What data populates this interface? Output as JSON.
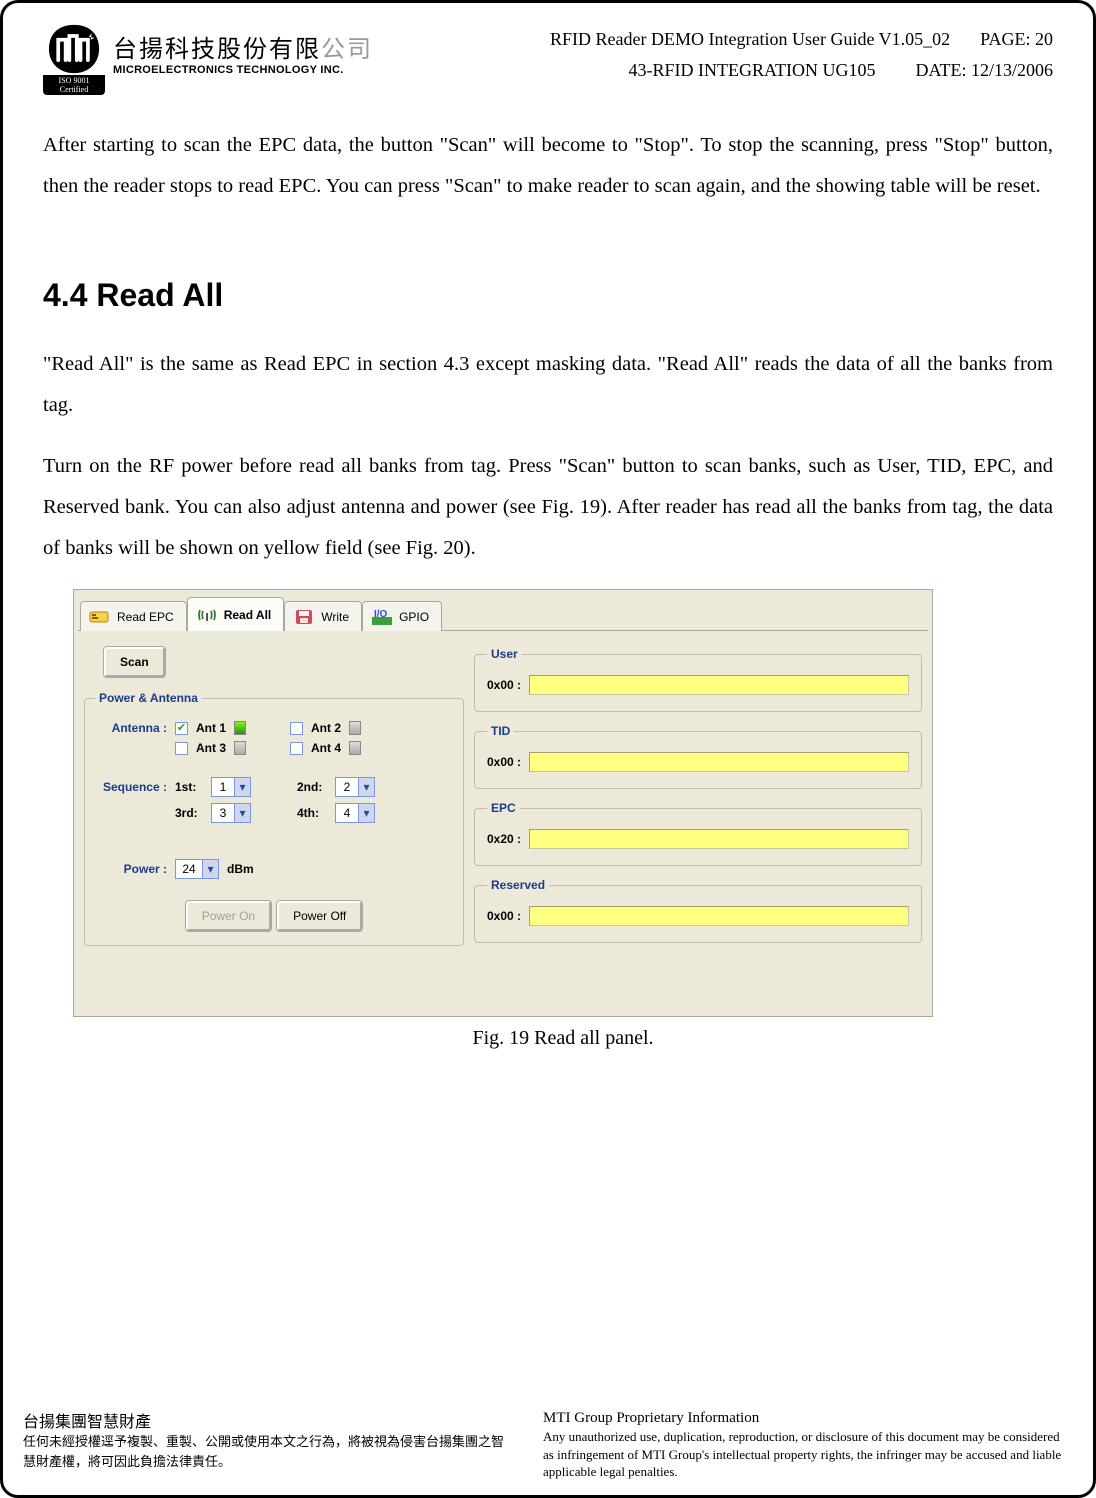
{
  "header": {
    "company_cn_main": "台揚科技股份有限",
    "company_cn_grey": "公司",
    "company_en": "MICROELECTRONICS TECHNOLOGY INC.",
    "iso_cert": "ISO 9001 Certified",
    "doc_title": "RFID Reader DEMO Integration User Guide V1.05_02",
    "page_label": "PAGE: 20",
    "doc_code": "43-RFID INTEGRATION UG105",
    "date_label": "DATE: 12/13/2006"
  },
  "paragraphs": {
    "p1": "After starting to scan the EPC data, the button \"Scan\" will become to \"Stop\". To stop the scanning, press \"Stop\" button, then the reader stops to read EPC.   You can press \"Scan\" to make reader to scan again, and the showing table will be reset.",
    "section_heading": "4.4  Read All",
    "p2": "\"Read All\" is the same as Read EPC in section 4.3 except masking data.   \"Read All\" reads the data of all the banks from tag.",
    "p3": "Turn on the RF power before read all banks from tag. Press \"Scan\" button to scan banks, such as User, TID, EPC, and Reserved bank.   You can also adjust antenna and power (see Fig. 19).   After reader has read all the banks from tag, the data of banks will be shown on yellow field (see Fig. 20)."
  },
  "app": {
    "tabs": {
      "read_epc": "Read EPC",
      "read_all": "Read All",
      "write": "Write",
      "gpio": "GPIO"
    },
    "scan_button": "Scan",
    "group_power_antenna": "Power & Antenna",
    "labels": {
      "antenna": "Antenna :",
      "ant1": "Ant 1",
      "ant2": "Ant 2",
      "ant3": "Ant 3",
      "ant4": "Ant 4",
      "sequence": "Sequence :",
      "seq1": "1st:",
      "seq2": "2nd:",
      "seq3": "3rd:",
      "seq4": "4th:",
      "power": "Power :",
      "dbm": "dBm"
    },
    "values": {
      "seq1": "1",
      "seq2": "2",
      "seq3": "3",
      "seq4": "4",
      "power": "24"
    },
    "buttons": {
      "power_on": "Power On",
      "power_off": "Power Off"
    },
    "readouts": {
      "user": {
        "legend": "User",
        "addr": "0x00 :"
      },
      "tid": {
        "legend": "TID",
        "addr": "0x00 :"
      },
      "epc": {
        "legend": "EPC",
        "addr": "0x20 :"
      },
      "reserved": {
        "legend": "Reserved",
        "addr": "0x00 :"
      }
    }
  },
  "fig_caption": "Fig. 19   Read all panel.",
  "footer": {
    "zh_title": "台揚集團智慧財產",
    "zh_body": "任何未經授權逕予複製、重製、公開或使用本文之行為，將被視為侵害台揚集團之智慧財產權，將可因此負擔法律責任。",
    "en_title": "MTI Group Proprietary Information",
    "en_body": "Any unauthorized use, duplication, reproduction, or disclosure of this document may be considered as infringement of MTI Group's intellectual property rights, the infringer may be accused and liable applicable legal penalties."
  }
}
